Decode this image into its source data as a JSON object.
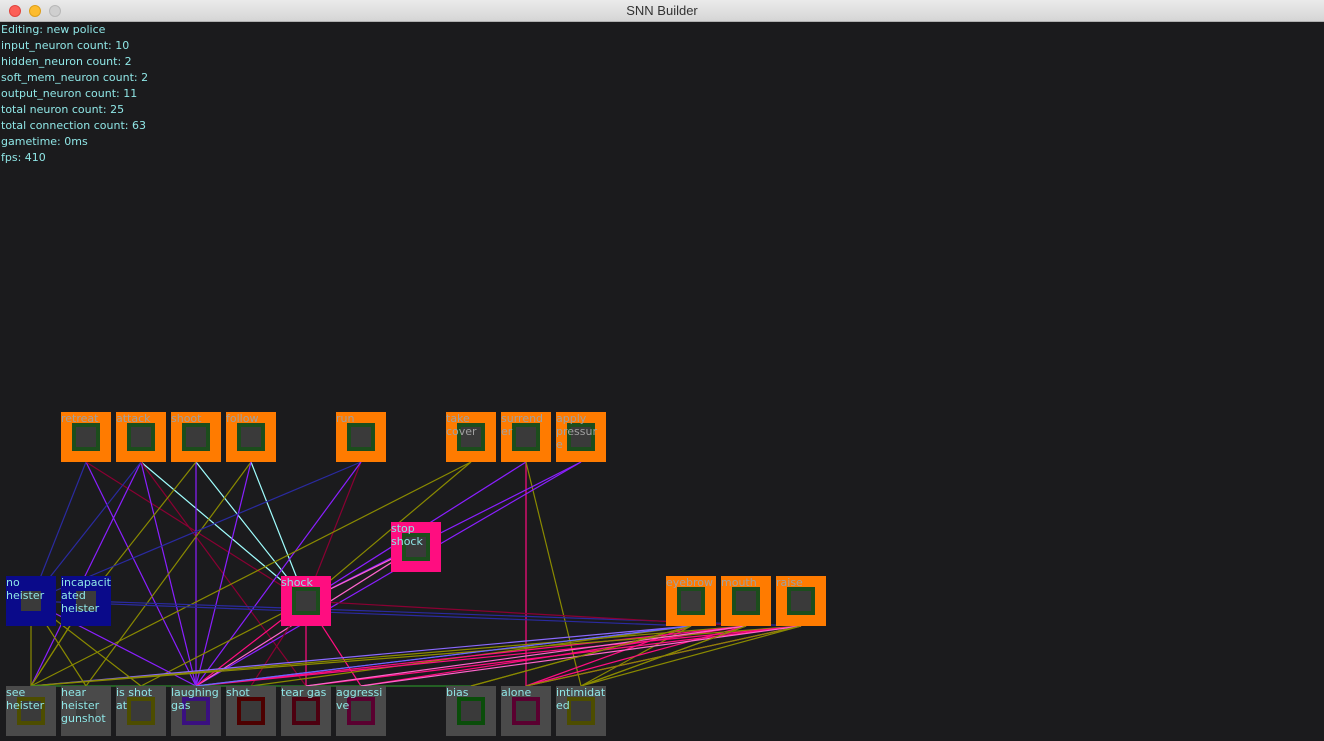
{
  "window": {
    "title": "SNN Builder"
  },
  "stats": [
    "Editing: new police",
    "input_neuron count: 10",
    "hidden_neuron count: 2",
    "soft_mem_neuron count: 2",
    "output_neuron count: 11",
    "total neuron count: 25",
    "total connection count: 63",
    "gametime: 0ms",
    "fps: 410"
  ],
  "colors": {
    "output": "#ff7b00",
    "soft_mem": "#ff0d80",
    "hidden": "#0a0a8a",
    "input": "#4a4a4a",
    "info_text": "#8fe6e6",
    "background": "#1b1b1d"
  },
  "neurons": {
    "retreat": {
      "label": "retreat",
      "type": "output",
      "inner_color": "#1c4d1c"
    },
    "attack": {
      "label": "attack",
      "type": "output",
      "inner_color": "#1c4d1c"
    },
    "shoot": {
      "label": "shoot",
      "type": "output",
      "inner_color": "#1c4d1c"
    },
    "follow": {
      "label": "follow",
      "type": "output",
      "inner_color": "#1c4d1c"
    },
    "run": {
      "label": "run",
      "type": "output",
      "inner_color": "#1c4d1c"
    },
    "take_cover": {
      "label": "take\ncover",
      "type": "output",
      "inner_color": "#1c4d1c"
    },
    "surrender": {
      "label": "surrend\ner",
      "type": "output",
      "inner_color": "#1c4d1c"
    },
    "apply_pressure": {
      "label": "apply\npressur\ne",
      "type": "output",
      "inner_color": "#1c4d1c"
    },
    "stop_shock": {
      "label": "stop\nshock",
      "type": "soft_mem",
      "inner_color": "#1c4d1c"
    },
    "shock": {
      "label": "shock",
      "type": "soft_mem",
      "inner_color": "#1c4d1c"
    },
    "no_heister": {
      "label": "no\nheister",
      "type": "hidden",
      "inner_color": "#0a0a8a"
    },
    "incapacitated_heister": {
      "label": "incapacit\nated\nheister",
      "type": "hidden",
      "inner_color": "#0a0a8a"
    },
    "eyebrow": {
      "label": "eyebrow",
      "type": "output",
      "inner_color": "#1c4d1c"
    },
    "mouth": {
      "label": "mouth",
      "type": "output",
      "inner_color": "#1c4d1c"
    },
    "raise": {
      "label": "raise",
      "type": "output",
      "inner_color": "#1c4d1c"
    },
    "see_heister": {
      "label": "see\nheister",
      "type": "input",
      "inner_color": "#4d4d00"
    },
    "hear_heister_gunshot": {
      "label": "hear\nheister\ngunshot",
      "type": "input",
      "inner_color": "#4a4a4a"
    },
    "is_shot_at": {
      "label": "is shot\nat",
      "type": "input",
      "inner_color": "#4d4d00"
    },
    "laughing_gas": {
      "label": "laughing\ngas",
      "type": "input",
      "inner_color": "#3a1080"
    },
    "shot": {
      "label": "shot",
      "type": "input",
      "inner_color": "#4d0000"
    },
    "tear_gas": {
      "label": "tear gas",
      "type": "input",
      "inner_color": "#4d0010"
    },
    "aggressive": {
      "label": "aggressi\nve",
      "type": "input",
      "inner_color": "#5a0030"
    },
    "bias": {
      "label": "bias",
      "type": "input",
      "inner_color": "#0a4d0a"
    },
    "alone": {
      "label": "alone",
      "type": "input",
      "inner_color": "#5a0030"
    },
    "intimidated": {
      "label": "intimidat\ned",
      "type": "input",
      "inner_color": "#4d4d00"
    }
  },
  "connections": [
    [
      "retreat",
      "laughing_gas",
      "#8a1fff"
    ],
    [
      "retreat",
      "shock",
      "#8a0033"
    ],
    [
      "retreat",
      "no_heister",
      "#2a2aa0"
    ],
    [
      "attack",
      "shock",
      "#a0ffff"
    ],
    [
      "attack",
      "laughing_gas",
      "#8a1fff"
    ],
    [
      "attack",
      "see_heister",
      "#8a1fff"
    ],
    [
      "attack",
      "no_heister",
      "#2a2aa0"
    ],
    [
      "attack",
      "tear_gas",
      "#8a0033"
    ],
    [
      "shoot",
      "shock",
      "#a0ffff"
    ],
    [
      "shoot",
      "laughing_gas",
      "#8a1fff"
    ],
    [
      "shoot",
      "incapacitated_heister",
      "#8a8a00"
    ],
    [
      "follow",
      "shock",
      "#a0ffff"
    ],
    [
      "follow",
      "hear_heister_gunshot",
      "#8a8a00"
    ],
    [
      "follow",
      "laughing_gas",
      "#8a1fff"
    ],
    [
      "run",
      "shock",
      "#8a0033"
    ],
    [
      "run",
      "no_heister",
      "#2a2aa0"
    ],
    [
      "run",
      "laughing_gas",
      "#8a1fff"
    ],
    [
      "take_cover",
      "shock",
      "#8a8a00"
    ],
    [
      "take_cover",
      "see_heister",
      "#8a8a00"
    ],
    [
      "surrender",
      "shock",
      "#8a1fff"
    ],
    [
      "surrender",
      "alone",
      "#ff0d80"
    ],
    [
      "surrender",
      "intimidated",
      "#8a8a00"
    ],
    [
      "apply_pressure",
      "shock",
      "#8a1fff"
    ],
    [
      "apply_pressure",
      "laughing_gas",
      "#8a1fff"
    ],
    [
      "stop_shock",
      "shock",
      "#ff66cc"
    ],
    [
      "stop_shock",
      "laughing_gas",
      "#ff66cc"
    ],
    [
      "shock",
      "laughing_gas",
      "#ff0d80"
    ],
    [
      "shock",
      "shot",
      "#8a0033"
    ],
    [
      "shock",
      "aggressive",
      "#ff0d80"
    ],
    [
      "shock",
      "tear_gas",
      "#ff0d80"
    ],
    [
      "shock",
      "is_shot_at",
      "#8a8a00"
    ],
    [
      "no_heister",
      "see_heister",
      "#8a8a00"
    ],
    [
      "no_heister",
      "eyebrow",
      "#2a2aa0"
    ],
    [
      "no_heister",
      "laughing_gas",
      "#8a1fff"
    ],
    [
      "incapacitated_heister",
      "see_heister",
      "#8a8a00"
    ],
    [
      "incapacitated_heister",
      "raise",
      "#2a2aa0"
    ],
    [
      "eyebrow",
      "see_heister",
      "#8a6aff"
    ],
    [
      "eyebrow",
      "bias",
      "#8a8a00"
    ],
    [
      "eyebrow",
      "alone",
      "#ff0d80"
    ],
    [
      "eyebrow",
      "intimidated",
      "#8a8a00"
    ],
    [
      "eyebrow",
      "laughing_gas",
      "#8a1fff"
    ],
    [
      "eyebrow",
      "shot",
      "#8a8a00"
    ],
    [
      "mouth",
      "see_heister",
      "#8a8a00"
    ],
    [
      "mouth",
      "alone",
      "#ff0d80"
    ],
    [
      "mouth",
      "intimidated",
      "#8a8a00"
    ],
    [
      "mouth",
      "laughing_gas",
      "#ff0d80"
    ],
    [
      "mouth",
      "shock",
      "#8a0033"
    ],
    [
      "mouth",
      "aggressive",
      "#ff0d80"
    ],
    [
      "raise",
      "alone",
      "#ff0d80"
    ],
    [
      "raise",
      "intimidated",
      "#8a8a00"
    ],
    [
      "raise",
      "see_heister",
      "#8a8a00"
    ],
    [
      "raise",
      "laughing_gas",
      "#ff0d80"
    ],
    [
      "raise",
      "tear_gas",
      "#ff0d80"
    ],
    [
      "see_heister",
      "incapacitated_heister",
      "#8a8a00"
    ],
    [
      "see_heister",
      "bias",
      "#2a8a2a"
    ],
    [
      "hear_heister_gunshot",
      "no_heister",
      "#8a8a00"
    ],
    [
      "is_shot_at",
      "no_heister",
      "#8a8a00"
    ],
    [
      "laughing_gas",
      "eyebrow",
      "#6a6aff"
    ],
    [
      "tear_gas",
      "mouth",
      "#ff66cc"
    ],
    [
      "aggressive",
      "raise",
      "#ff66cc"
    ],
    [
      "bias",
      "eyebrow",
      "#8a8a00"
    ],
    [
      "alone",
      "raise",
      "#8a8a00"
    ],
    [
      "intimidated",
      "mouth",
      "#8a8a00"
    ]
  ]
}
